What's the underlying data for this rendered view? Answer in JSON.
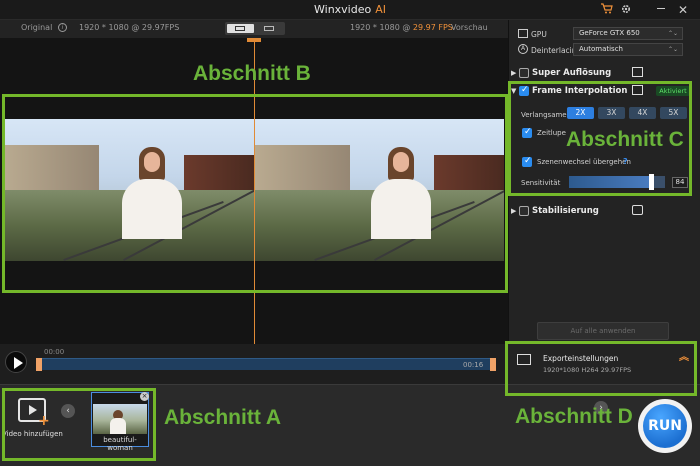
{
  "app": {
    "title": "Winxvideo",
    "title_suffix": "AI"
  },
  "icons": {
    "cart": "cart-icon",
    "settings": "gear-icon",
    "minimize": "minimize-icon",
    "close": "close-icon"
  },
  "preview": {
    "original_label": "Original",
    "info_icon": "i",
    "left_meta": "1920 * 1080 @ 29.97FPS",
    "right_meta": "1920 * 1080 @ ",
    "right_fps": "29.97 FPS",
    "preview_label": "Vorschau"
  },
  "timeline": {
    "start_time": "00:00",
    "end_time": "00:16"
  },
  "bottom": {
    "add_video_label": "Video hinzufügen",
    "thumbnail_label": "beautiful-woman",
    "close_glyph": "×",
    "nav_left": "‹",
    "nav_right": "›"
  },
  "settings": {
    "gpu_label": "GPU",
    "gpu_value": "GeForce GTX 650",
    "deinterlacing_label": "Deinterlacing",
    "deinterlacing_value": "Automatisch"
  },
  "sections": {
    "super_res": {
      "title": "Super Auflösung",
      "checked": false
    },
    "frame_interp": {
      "title": "Frame Interpolation",
      "checked": true,
      "badge": "Aktiviert",
      "slowdown_label": "Verlangsamen",
      "options": [
        "2X",
        "3X",
        "4X",
        "5X"
      ],
      "selected": "2X",
      "zeitlupe_label": "Zeitlupe",
      "scene_label": "Szenenwechsel übergehen",
      "help_glyph": "?",
      "sensitivity_label": "Sensitivität",
      "sensitivity_value": "84"
    },
    "stabilization": {
      "title": "Stabilisierung",
      "checked": false
    }
  },
  "apply_all_label": "Auf alle anwenden",
  "export": {
    "title": "Exporteinstellungen",
    "detail": "1920*1080   H264   29.97FPS"
  },
  "run_label": "RUN",
  "annotations": {
    "a": "Abschnitt A",
    "b": "Abschnitt B",
    "c": "Abschnitt C",
    "d": "Abschnitt D"
  },
  "colors": {
    "accent": "#f0913a",
    "annotation": "#74b82a",
    "selected_button": "#2d7fe0"
  }
}
